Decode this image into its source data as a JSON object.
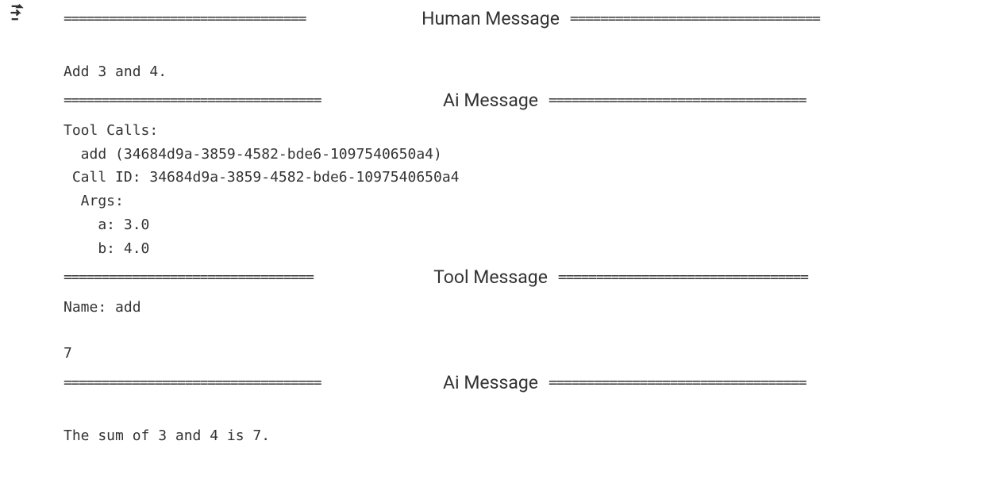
{
  "headers": {
    "human": "Human Message",
    "ai1": "Ai Message",
    "tool": "Tool Message",
    "ai2": "Ai Message"
  },
  "human": {
    "text": "Add 3 and 4."
  },
  "ai1": {
    "tool_calls_label": "Tool Calls:",
    "tool_name_line": "  add (34684d9a-3859-4582-bde6-1097540650a4)",
    "call_id_line": " Call ID: 34684d9a-3859-4582-bde6-1097540650a4",
    "args_label": "  Args:",
    "arg_a": "    a: 3.0",
    "arg_b": "    b: 4.0"
  },
  "tool": {
    "name_line": "Name: add",
    "result": "7"
  },
  "ai2": {
    "text": "The sum of 3 and 4 is 7."
  }
}
